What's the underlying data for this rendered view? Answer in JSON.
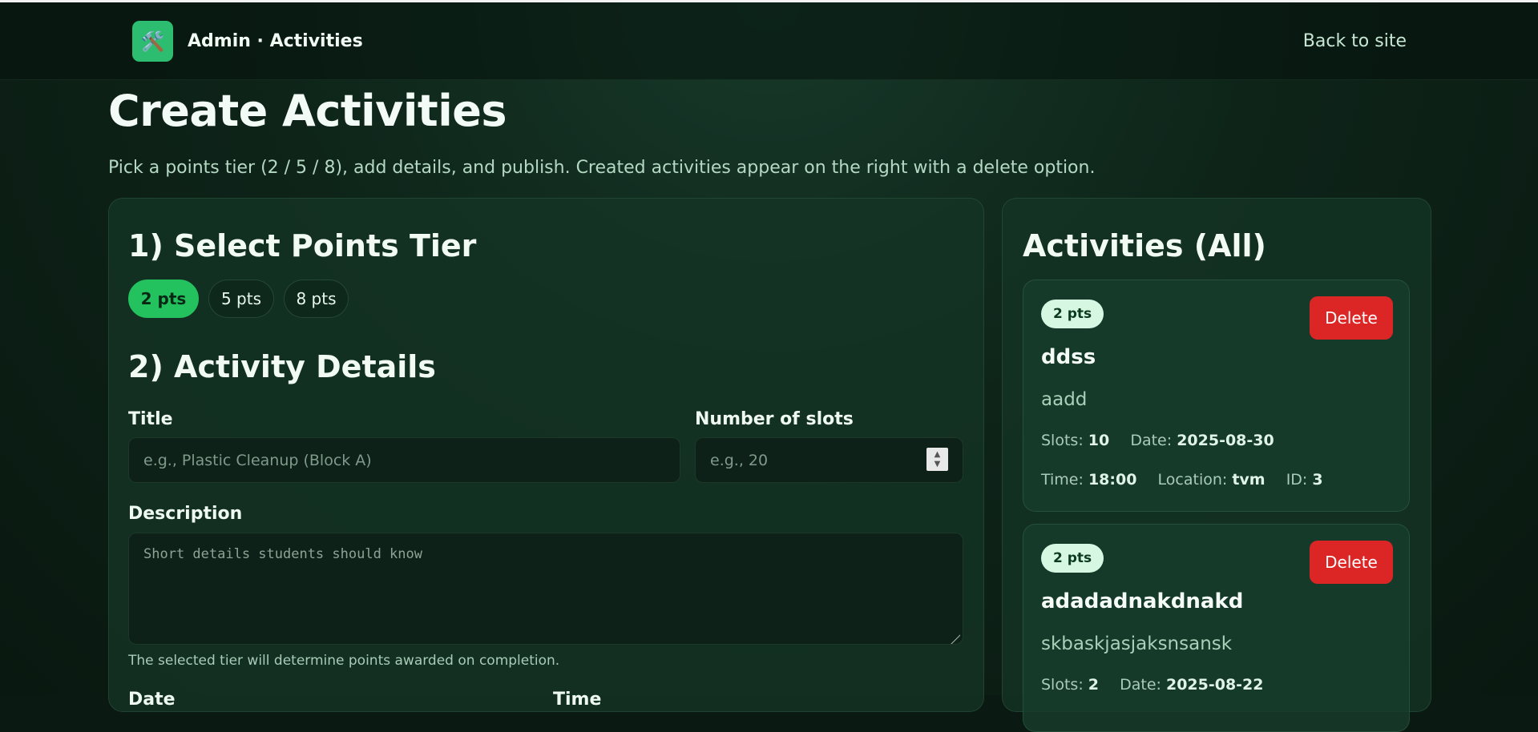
{
  "header": {
    "logo_icon": "🛠️",
    "brand": "Admin · Activities",
    "back_link": "Back to site"
  },
  "page": {
    "title": "Create Activities",
    "subtitle": "Pick a points tier (2 / 5 / 8), add details, and publish. Created activities appear on the right with a delete option."
  },
  "form": {
    "tier_heading": "1) Select Points Tier",
    "tiers": [
      "2 pts",
      "5 pts",
      "8 pts"
    ],
    "selected_tier": "2 pts",
    "details_heading": "2) Activity Details",
    "title_label": "Title",
    "title_placeholder": "e.g., Plastic Cleanup (Block A)",
    "slots_label": "Number of slots",
    "slots_placeholder": "e.g., 20",
    "description_label": "Description",
    "description_placeholder": "Short details students should know",
    "hint": "The selected tier will determine points awarded on completion.",
    "date_label": "Date",
    "time_label": "Time"
  },
  "activities": {
    "heading": "Activities (All)",
    "delete_label": "Delete",
    "slots_label": "Slots:",
    "date_label": "Date:",
    "time_label": "Time:",
    "location_label": "Location:",
    "id_label": "ID:",
    "items": [
      {
        "points": "2 pts",
        "title": "ddss",
        "description": "aadd",
        "slots": "10",
        "date": "2025-08-30",
        "time": "18:00",
        "location": "tvm",
        "id": "3"
      },
      {
        "points": "2 pts",
        "title": "adadadnakdnakd",
        "description": "skbaskjasjaksnsansk",
        "slots": "2",
        "date": "2025-08-22"
      }
    ]
  },
  "colors": {
    "accent": "#23c25e",
    "danger": "#dc2626",
    "badge_bg": "#d6f7e2"
  }
}
